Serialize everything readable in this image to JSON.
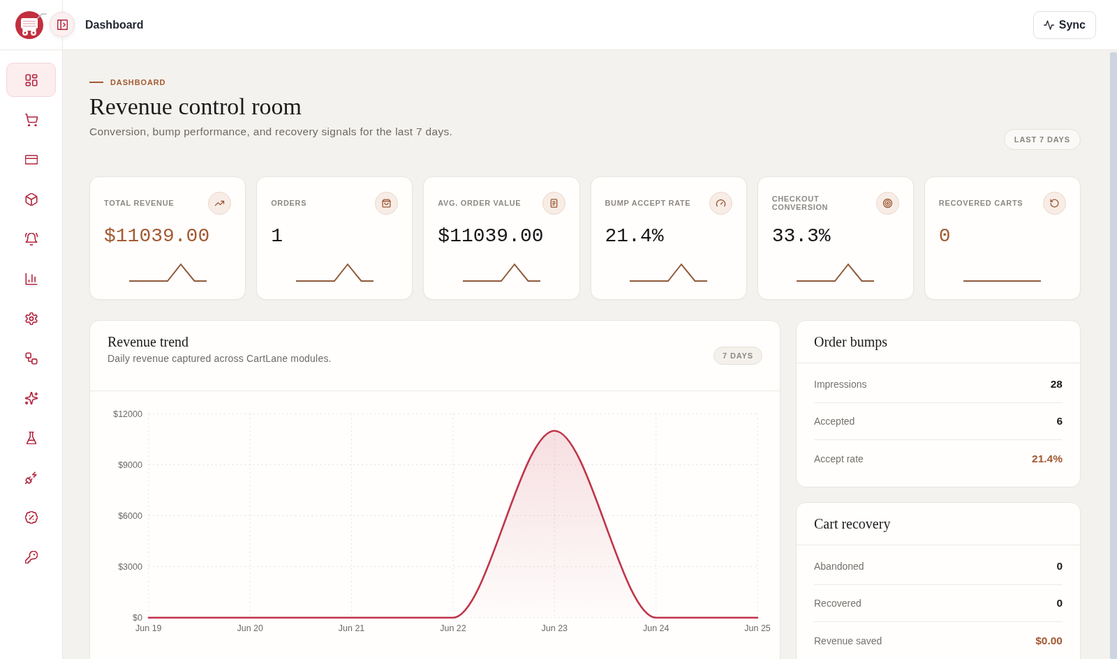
{
  "header": {
    "title": "Dashboard",
    "sync_button": "Sync"
  },
  "sidebar": {
    "items": [
      {
        "selected": true
      },
      {
        "selected": false
      },
      {
        "selected": false
      },
      {
        "selected": false
      },
      {
        "selected": false
      },
      {
        "selected": false
      },
      {
        "selected": false
      },
      {
        "selected": false
      },
      {
        "selected": false
      },
      {
        "selected": false
      },
      {
        "selected": false
      },
      {
        "selected": false
      },
      {
        "selected": false
      }
    ]
  },
  "page": {
    "eyebrow": "DASHBOARD",
    "title": "Revenue control room",
    "subtitle": "Conversion, bump performance, and recovery signals for the last 7 days.",
    "range_badge": "LAST 7 DAYS"
  },
  "kpis": [
    {
      "label": "TOTAL REVENUE",
      "value": "$11039.00",
      "accent": true,
      "kind": "peak"
    },
    {
      "label": "ORDERS",
      "value": "1",
      "accent": false,
      "kind": "peak"
    },
    {
      "label": "AVG. ORDER VALUE",
      "value": "$11039.00",
      "accent": false,
      "kind": "peak"
    },
    {
      "label": "BUMP ACCEPT RATE",
      "value": "21.4%",
      "accent": false,
      "kind": "peak"
    },
    {
      "label": "CHECKOUT CONVERSION",
      "value": "33.3%",
      "accent": false,
      "kind": "peak"
    },
    {
      "label": "RECOVERED CARTS",
      "value": "0",
      "accent": true,
      "kind": "flat"
    }
  ],
  "revenue_trend": {
    "title": "Revenue trend",
    "subtitle": "Daily revenue captured across CartLane modules.",
    "badge": "7 DAYS",
    "chart_data": {
      "type": "area",
      "categories": [
        "Jun 19",
        "Jun 20",
        "Jun 21",
        "Jun 22",
        "Jun 23",
        "Jun 24",
        "Jun 25"
      ],
      "values": [
        0,
        0,
        0,
        0,
        11000,
        0,
        0
      ],
      "ylim": [
        0,
        12000
      ],
      "yticks": [
        {
          "value": 0,
          "label": "$0"
        },
        {
          "value": 3000,
          "label": "$3000"
        },
        {
          "value": 6000,
          "label": "$6000"
        },
        {
          "value": 9000,
          "label": "$9000"
        },
        {
          "value": 12000,
          "label": "$12000"
        }
      ],
      "grid": true
    }
  },
  "order_bumps": {
    "title": "Order bumps",
    "rows": [
      {
        "label": "Impressions",
        "value": "28",
        "accent": false
      },
      {
        "label": "Accepted",
        "value": "6",
        "accent": false
      },
      {
        "label": "Accept rate",
        "value": "21.4%",
        "accent": true
      }
    ]
  },
  "cart_recovery": {
    "title": "Cart recovery",
    "rows": [
      {
        "label": "Abandoned",
        "value": "0",
        "accent": false
      },
      {
        "label": "Recovered",
        "value": "0",
        "accent": false
      },
      {
        "label": "Revenue saved",
        "value": "$0.00",
        "accent": true
      }
    ]
  }
}
